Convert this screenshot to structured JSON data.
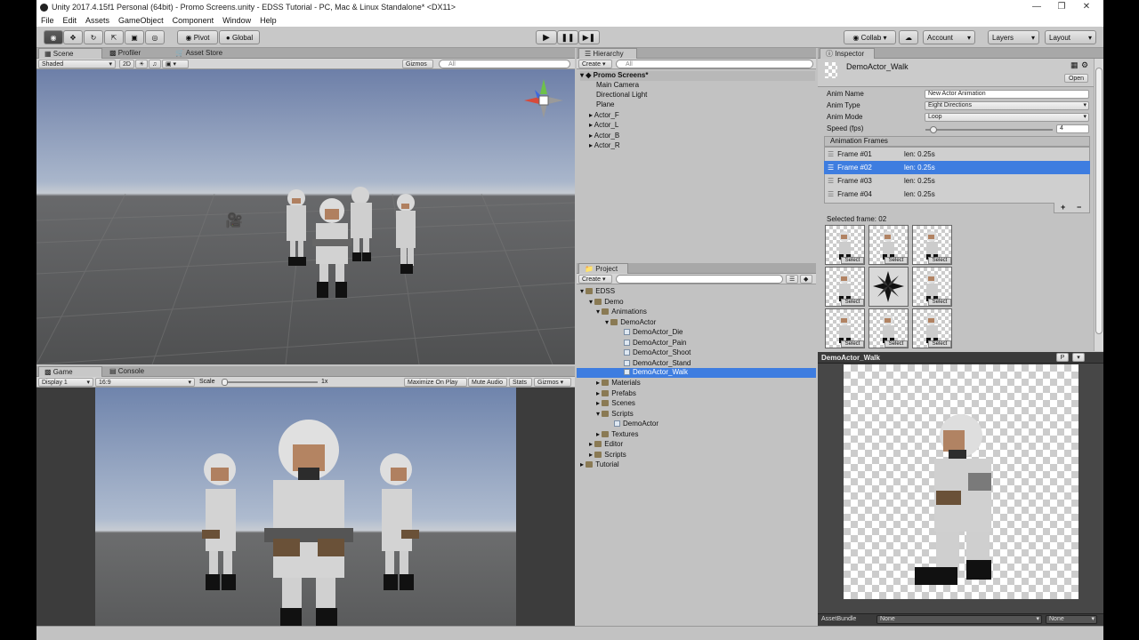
{
  "window": {
    "title": "Unity 2017.4.15f1 Personal (64bit) - Promo Screens.unity - EDSS Tutorial - PC, Mac & Linux Standalone* <DX11>"
  },
  "menu": [
    "File",
    "Edit",
    "Assets",
    "GameObject",
    "Component",
    "Window",
    "Help"
  ],
  "toolbar": {
    "pivot": "Pivot",
    "global": "Global",
    "collab": "Collab",
    "account": "Account",
    "layers": "Layers",
    "layout": "Layout"
  },
  "scene": {
    "tab": "Scene",
    "profiler_tab": "Profiler",
    "asset_tab": "Asset Store",
    "shaded": "Shaded",
    "mode_2d": "2D",
    "gizmos": "Gizmos",
    "search_placeholder": "All"
  },
  "game": {
    "tab": "Game",
    "console_tab": "Console",
    "display": "Display 1",
    "aspect": "16:9",
    "scale_label": "Scale",
    "scale_value": "1x",
    "maximize": "Maximize On Play",
    "mute": "Mute Audio",
    "stats": "Stats",
    "gizmos": "Gizmos"
  },
  "hierarchy": {
    "tab": "Hierarchy",
    "create": "Create",
    "scene_name": "Promo Screens*",
    "items": [
      "Main Camera",
      "Directional Light",
      "Plane",
      "Actor_F",
      "Actor_L",
      "Actor_B",
      "Actor_R"
    ]
  },
  "project": {
    "tab": "Project",
    "create": "Create",
    "tree": [
      {
        "label": "EDSS",
        "depth": 0,
        "type": "folder"
      },
      {
        "label": "Demo",
        "depth": 1,
        "type": "folder"
      },
      {
        "label": "Animations",
        "depth": 2,
        "type": "folder"
      },
      {
        "label": "DemoActor",
        "depth": 3,
        "type": "folder"
      },
      {
        "label": "DemoActor_Die",
        "depth": 4,
        "type": "asset"
      },
      {
        "label": "DemoActor_Pain",
        "depth": 4,
        "type": "asset"
      },
      {
        "label": "DemoActor_Shoot",
        "depth": 4,
        "type": "asset"
      },
      {
        "label": "DemoActor_Stand",
        "depth": 4,
        "type": "asset"
      },
      {
        "label": "DemoActor_Walk",
        "depth": 4,
        "type": "asset",
        "selected": true
      },
      {
        "label": "Materials",
        "depth": 2,
        "type": "folder"
      },
      {
        "label": "Prefabs",
        "depth": 2,
        "type": "folder"
      },
      {
        "label": "Scenes",
        "depth": 2,
        "type": "folder"
      },
      {
        "label": "Scripts",
        "depth": 2,
        "type": "folder"
      },
      {
        "label": "DemoActor",
        "depth": 3,
        "type": "script"
      },
      {
        "label": "Textures",
        "depth": 2,
        "type": "folder"
      },
      {
        "label": "Editor",
        "depth": 1,
        "type": "folder"
      },
      {
        "label": "Scripts",
        "depth": 1,
        "type": "folder"
      },
      {
        "label": "Tutorial",
        "depth": 0,
        "type": "folder"
      }
    ]
  },
  "inspector": {
    "tab": "Inspector",
    "asset_name": "DemoActor_Walk",
    "open": "Open",
    "fields": {
      "anim_name_label": "Anim Name",
      "anim_name": "New Actor Animation",
      "anim_type_label": "Anim Type",
      "anim_type": "Eight Directions",
      "anim_mode_label": "Anim Mode",
      "anim_mode": "Loop",
      "speed_label": "Speed (fps)",
      "speed": "4"
    },
    "frames_header": "Animation Frames",
    "frames": [
      {
        "label": "Frame #01",
        "len": "len: 0.25s"
      },
      {
        "label": "Frame #02",
        "len": "len: 0.25s",
        "selected": true
      },
      {
        "label": "Frame #03",
        "len": "len: 0.25s"
      },
      {
        "label": "Frame #04",
        "len": "len: 0.25s"
      }
    ],
    "plus": "+",
    "minus": "−",
    "selected_frame": "Selected frame: 02",
    "select_label": "Select"
  },
  "preview": {
    "title": "DemoActor_Walk",
    "p_button": "P",
    "assetbundle_label": "AssetBundle",
    "bundle_value": "None",
    "variant_value": "None"
  },
  "colors": {
    "selection": "#3e7de0",
    "sky_top": "#7b8fb3",
    "ground": "#5c5c5c"
  }
}
